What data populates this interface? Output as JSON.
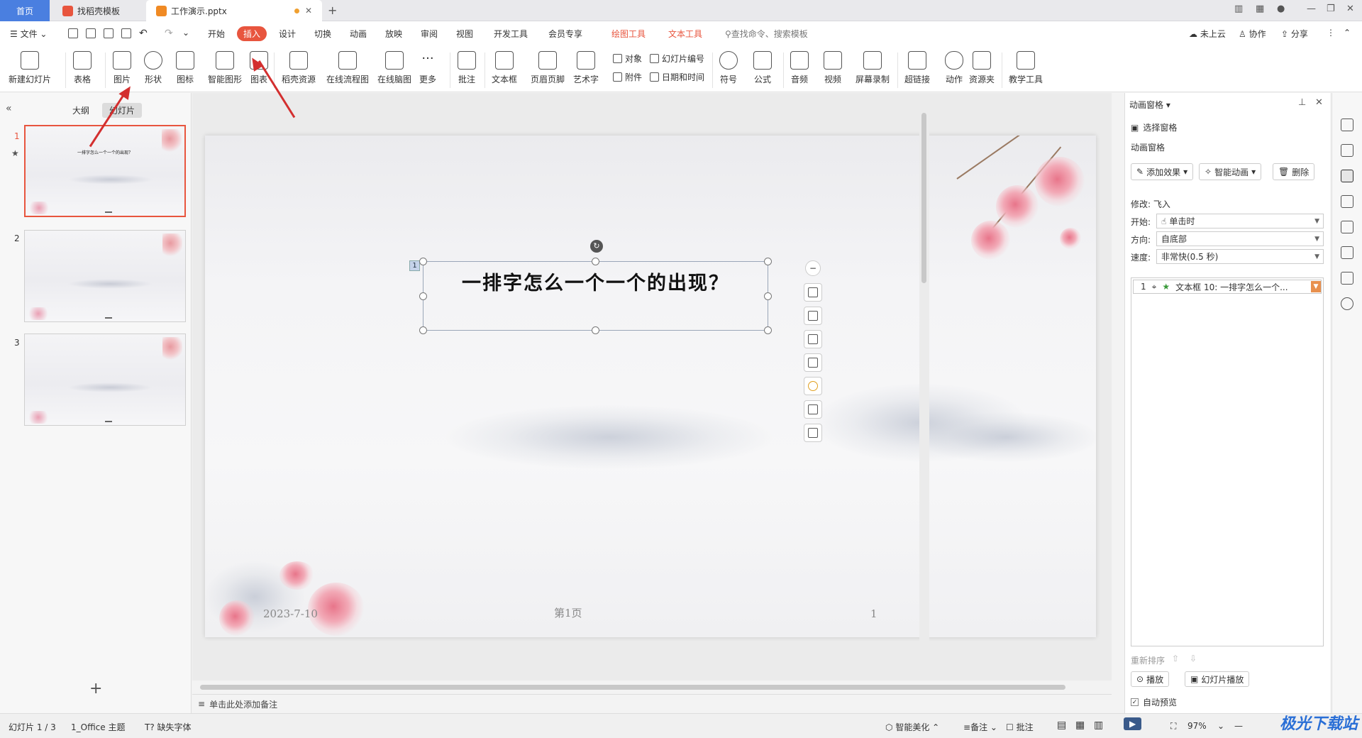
{
  "tabs": {
    "home": "首页",
    "template": "找稻壳模板",
    "doc": "工作演示.pptx"
  },
  "menu": {
    "file": "文件",
    "items": [
      "开始",
      "插入",
      "设计",
      "切换",
      "动画",
      "放映",
      "审阅",
      "视图",
      "开发工具",
      "会员专享"
    ],
    "active": "插入",
    "drawing_tools": "绘图工具",
    "text_tools": "文本工具",
    "search": "查找命令、搜索模板",
    "cloud": "未上云",
    "collab": "协作",
    "share": "分享"
  },
  "ribbon": {
    "new_slide": "新建幻灯片",
    "table": "表格",
    "picture": "图片",
    "shape": "形状",
    "icon": "图标",
    "smart_graphic": "智能图形",
    "chart": "图表",
    "resource": "稻壳资源",
    "flowchart": "在线流程图",
    "mindmap": "在线脑图",
    "more": "更多",
    "comment": "批注",
    "textbox": "文本框",
    "header_footer": "页眉页脚",
    "art_text": "艺术字",
    "object": "对象",
    "slide_number": "幻灯片编号",
    "attachment": "附件",
    "datetime": "日期和时间",
    "symbol": "符号",
    "formula": "公式",
    "audio": "音频",
    "video": "视频",
    "screen_record": "屏幕录制",
    "hyperlink": "超链接",
    "action": "动作",
    "resource_folder": "资源夹",
    "teaching_tools": "教学工具"
  },
  "left_panel": {
    "outline_tab": "大纲",
    "slides_tab": "幻灯片",
    "slide_numbers": [
      "1",
      "2",
      "3"
    ],
    "thumb_title": "一排字怎么一个一个的出现？"
  },
  "slide": {
    "title": "一排字怎么一个一个的出现？",
    "anim_index": "1",
    "date": "2023-7-10",
    "page_label": "第1页",
    "number": "1"
  },
  "notes_placeholder": "单击此处添加备注",
  "right_panel": {
    "header": "动画窗格",
    "select_pane": "选择窗格",
    "anim_pane": "动画窗格",
    "add_effect": "添加效果",
    "smart_anim": "智能动画",
    "delete": "删除",
    "modify": "修改: 飞入",
    "start_label": "开始:",
    "start_value": "单击时",
    "direction_label": "方向:",
    "direction_value": "自底部",
    "speed_label": "速度:",
    "speed_value": "非常快(0.5 秒)",
    "item_index": "1",
    "item_text": "文本框 10: 一排字怎么一个...",
    "reorder": "重新排序",
    "play": "播放",
    "slideshow": "幻灯片播放",
    "autopreview": "自动预览"
  },
  "status": {
    "slide_pos": "幻灯片 1 / 3",
    "theme": "1_Office 主题",
    "missing_font": "缺失字体",
    "beautify": "智能美化",
    "notes": "备注",
    "comments": "批注",
    "zoom": "97%"
  },
  "watermark": "极光下载站"
}
